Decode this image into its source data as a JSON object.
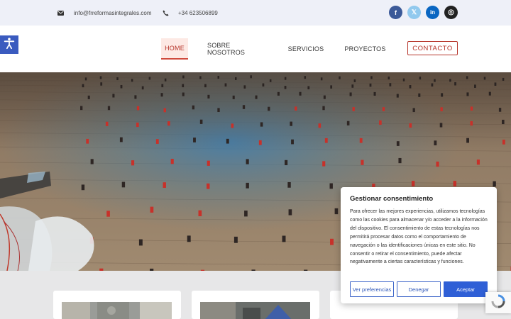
{
  "topbar": {
    "email": "info@frreformasintegrales.com",
    "phone": "+34 623506899",
    "social": [
      {
        "name": "facebook",
        "glyph": "f",
        "color": "#3b5998"
      },
      {
        "name": "x",
        "glyph": "𝕏",
        "color": "#91c9ee"
      },
      {
        "name": "linkedin",
        "glyph": "in",
        "color": "#0a66c2"
      },
      {
        "name": "instagram",
        "glyph": "◎",
        "color": "#222222"
      }
    ]
  },
  "nav": {
    "items": [
      {
        "label": "HOME",
        "active": true
      },
      {
        "label": "SOBRE NOSOTROS",
        "active": false
      },
      {
        "label": "SERVICIOS",
        "active": false
      },
      {
        "label": "PROYECTOS",
        "active": false
      }
    ],
    "contact_label": "CONTACTO",
    "accent": "#b6352b"
  },
  "accessibility": {
    "icon": "accessibility-icon",
    "color": "#3a5bbf"
  },
  "hero": {
    "icon": "tile-floor-photo"
  },
  "consent": {
    "title": "Gestionar consentimiento",
    "text": "Para ofrecer las mejores experiencias, utilizamos tecnologías como las cookies para almacenar y/o acceder a la información del dispositivo. El consentimiento de estas tecnologías nos permitirá procesar datos como el comportamiento de navegación o las identificaciones únicas en este sitio. No consentir o retirar el consentimiento, puede afectar negativamente a ciertas características y funciones.",
    "buttons": {
      "preferences": "Ver preferencias",
      "deny": "Denegar",
      "accept": "Aceptar"
    }
  }
}
